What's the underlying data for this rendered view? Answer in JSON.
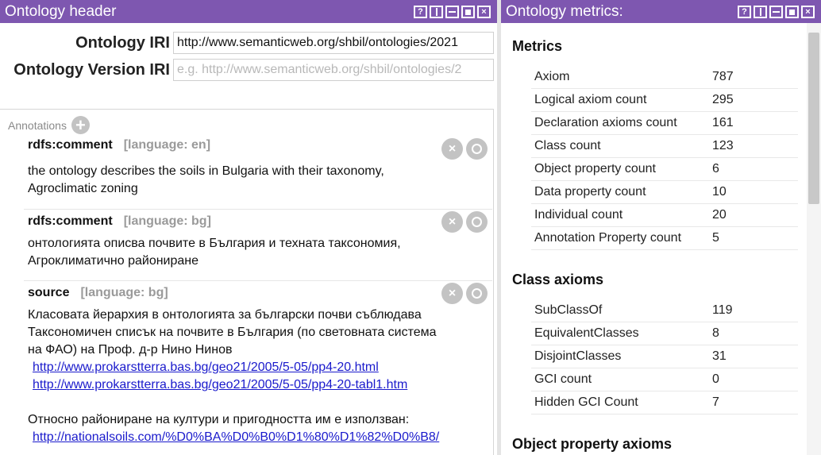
{
  "left_panel": {
    "title": "Ontology header",
    "buttons": [
      "?",
      "",
      "",
      "",
      "×"
    ],
    "ontology_iri_label": "Ontology IRI",
    "ontology_iri_value": "http://www.semanticweb.org/shbil/ontologies/2021",
    "version_iri_label": "Ontology Version IRI",
    "version_iri_placeholder": "e.g. http://www.semanticweb.org/shbil/ontologies/2",
    "annotations_label": "Annotations",
    "annotations": [
      {
        "property": "rdfs:comment",
        "language": "[language: en]",
        "lines": [
          "the ontology describes the soils in Bulgaria with their taxonomy,",
          "Agroclimatic zoning"
        ],
        "links": []
      },
      {
        "property": "rdfs:comment",
        "language": "[language: bg]",
        "lines": [
          "онтологията описва почвите в България и техната таксономия,",
          "Агроклиматично райониране"
        ],
        "links": []
      },
      {
        "property": "source",
        "language": "[language: bg]",
        "lines": [
          "Класовата йерархия в онтологията за български почви съблюдава",
          "Таксономичен списък на почвите в България (по световната система",
          "на ФАО) на Проф. д-р Нино Нинов"
        ],
        "links": [
          "http://www.prokarstterra.bas.bg/geo21/2005/5-05/pp4-20.html",
          "http://www.prokarstterra.bas.bg/geo21/2005/5-05/pp4-20-tabl1.htm"
        ],
        "note": "Относно райониране на култури и пригодността им е използван:",
        "note_link": "http://nationalsoils.com/%D0%BA%D0%B0%D1%80%D1%82%D0%B8/"
      }
    ]
  },
  "right_panel": {
    "title": "Ontology metrics:",
    "buttons": [
      "?",
      "",
      "",
      "",
      "×"
    ],
    "sections": [
      {
        "title": "Metrics",
        "rows": [
          {
            "label": "Axiom",
            "value": "787"
          },
          {
            "label": "Logical axiom count",
            "value": "295"
          },
          {
            "label": "Declaration axioms count",
            "value": "161"
          },
          {
            "label": "Class count",
            "value": "123"
          },
          {
            "label": "Object property count",
            "value": "6"
          },
          {
            "label": "Data property count",
            "value": "10"
          },
          {
            "label": "Individual count",
            "value": "20"
          },
          {
            "label": "Annotation Property count",
            "value": "5"
          }
        ]
      },
      {
        "title": "Class axioms",
        "rows": [
          {
            "label": "SubClassOf",
            "value": "119"
          },
          {
            "label": "EquivalentClasses",
            "value": "8"
          },
          {
            "label": "DisjointClasses",
            "value": "31"
          },
          {
            "label": "GCI count",
            "value": "0"
          },
          {
            "label": "Hidden GCI Count",
            "value": "7"
          }
        ]
      },
      {
        "title": "Object property axioms",
        "rows": []
      }
    ]
  },
  "colors": {
    "titlebar": "#7e57b0",
    "link": "#1a1acc",
    "icon_grey": "#c3c3c3"
  }
}
